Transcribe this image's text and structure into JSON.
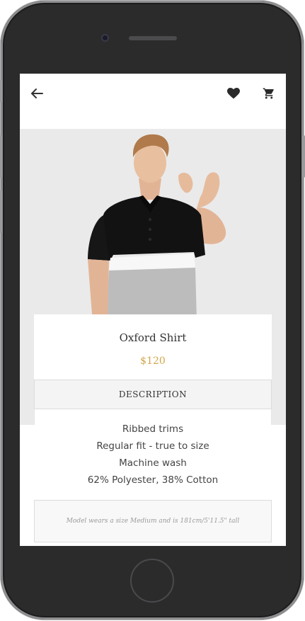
{
  "header": {
    "back_icon": "arrow-left-icon",
    "favorite_icon": "heart-icon",
    "cart_icon": "shopping-cart-icon"
  },
  "product": {
    "name": "Oxford Shirt",
    "price": "$120",
    "image": "model-wearing-polo-shirt"
  },
  "description": {
    "tab_label": "DESCRIPTION",
    "lines": [
      "Ribbed trims",
      "Regular fit - true to size",
      "Machine wash",
      "62% Polyester, 38% Cotton"
    ],
    "note": "Model wears a size Medium and is 181cm/5'11.5\" tall"
  },
  "colors": {
    "accent_price": "#d1a64a",
    "hero_background": "#eaeaea"
  }
}
